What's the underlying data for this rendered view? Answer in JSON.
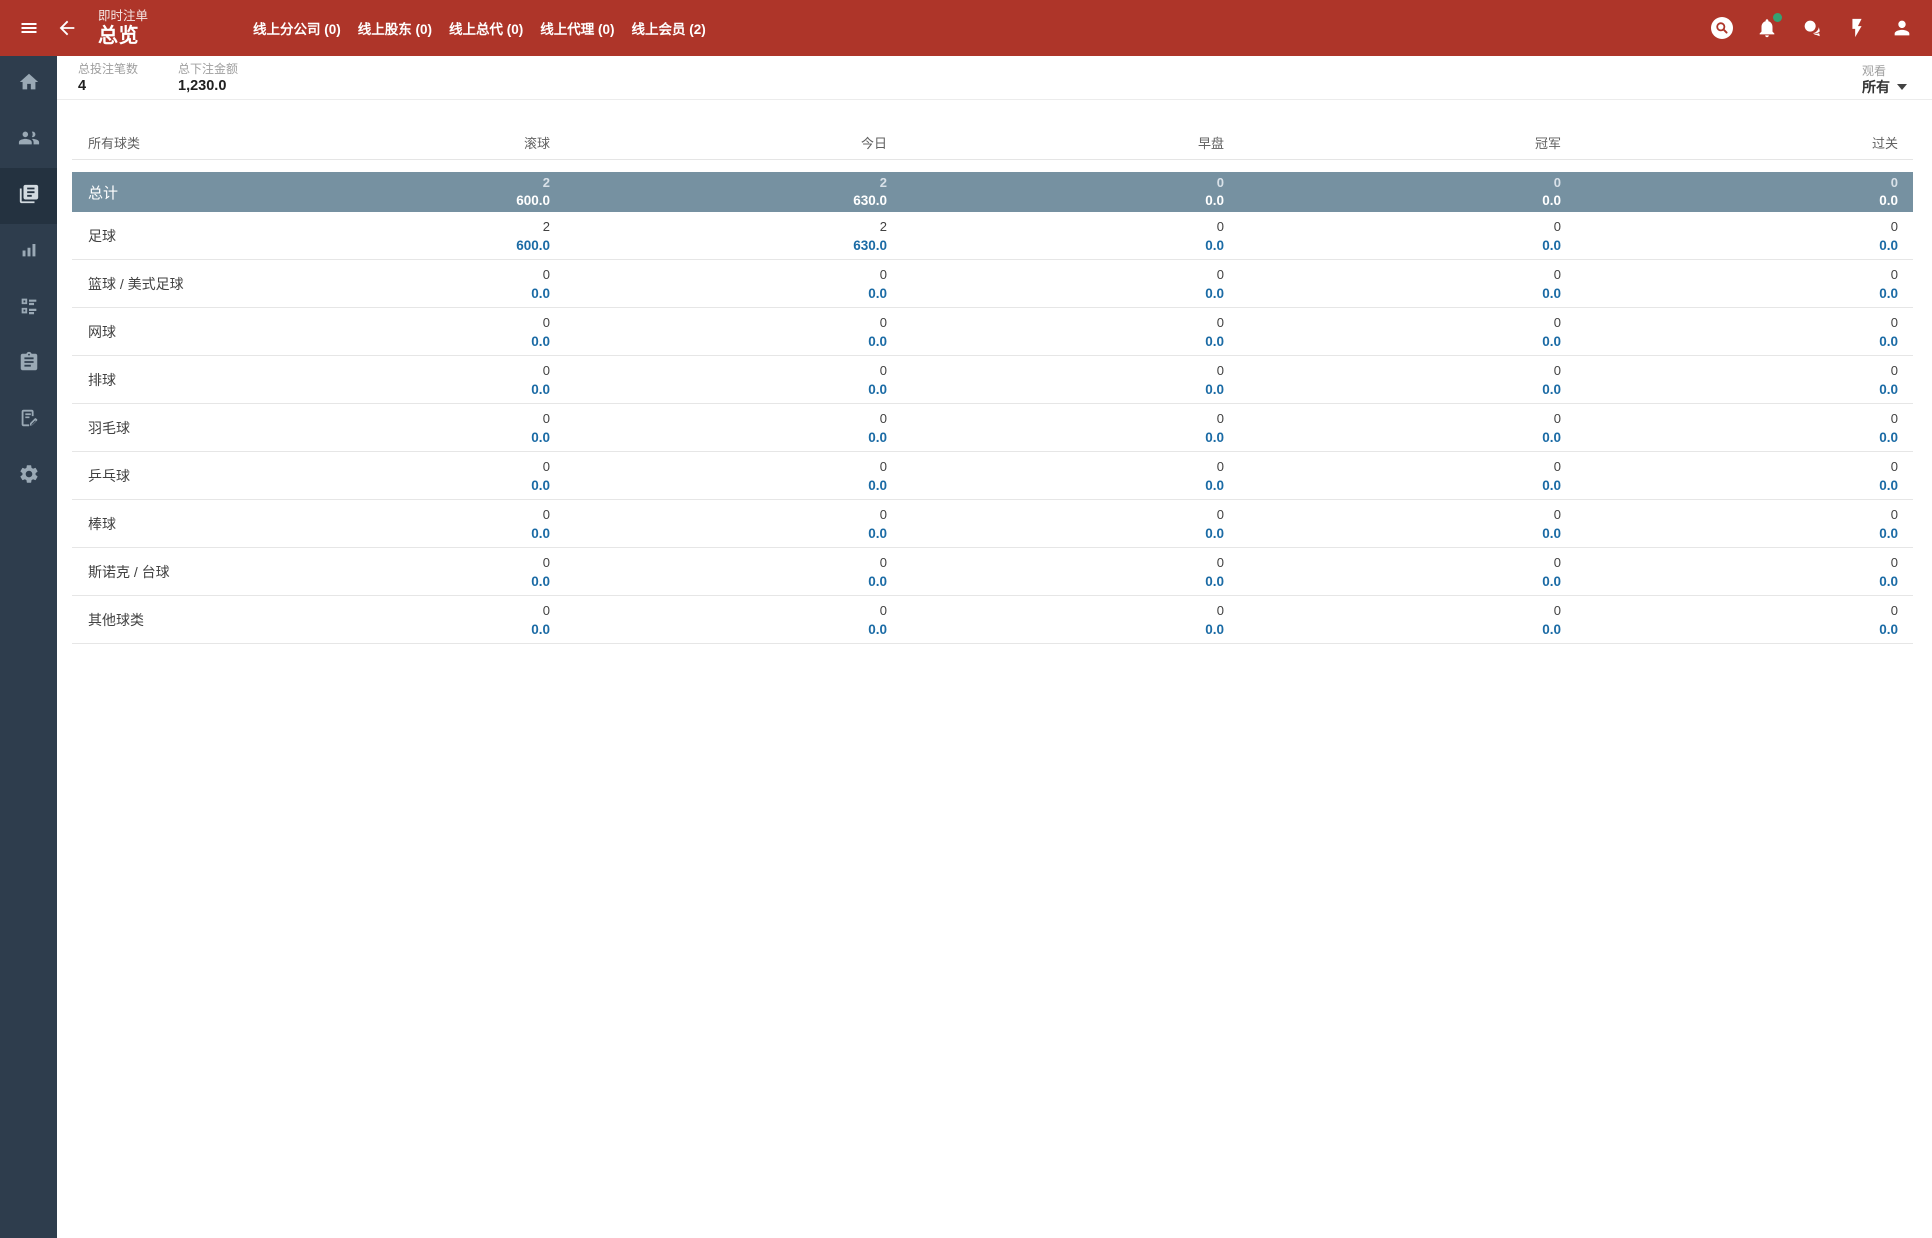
{
  "header": {
    "subtitle": "即时注单",
    "title": "总览",
    "tabs": [
      {
        "label": "线上分公司 (0)"
      },
      {
        "label": "线上股东 (0)"
      },
      {
        "label": "线上总代 (0)"
      },
      {
        "label": "线上代理 (0)"
      },
      {
        "label": "线上会员 (2)"
      }
    ],
    "action_icons": [
      "search-icon",
      "notifications-icon",
      "chat-icon",
      "flash-icon",
      "account-icon"
    ],
    "notification_dot": true
  },
  "sidebar_icons": [
    "home-icon",
    "people-icon",
    "bets-icon",
    "chart-icon",
    "ballot-icon",
    "clipboard-icon",
    "report-edit-icon",
    "settings-icon"
  ],
  "sidebar_active_index": 2,
  "stats": [
    {
      "label": "总投注笔数",
      "value": "4"
    },
    {
      "label": "总下注金额",
      "value": "1,230.0"
    }
  ],
  "watch": {
    "label": "观看",
    "value": "所有"
  },
  "table": {
    "columns": [
      "所有球类",
      "滚球",
      "今日",
      "早盘",
      "冠军",
      "过关"
    ],
    "total_row": {
      "label": "总计",
      "cells": [
        {
          "count": "2",
          "amount": "600.0"
        },
        {
          "count": "2",
          "amount": "630.0"
        },
        {
          "count": "0",
          "amount": "0.0"
        },
        {
          "count": "0",
          "amount": "0.0"
        },
        {
          "count": "0",
          "amount": "0.0"
        }
      ]
    },
    "rows": [
      {
        "label": "足球",
        "cells": [
          {
            "count": "2",
            "amount": "600.0"
          },
          {
            "count": "2",
            "amount": "630.0"
          },
          {
            "count": "0",
            "amount": "0.0"
          },
          {
            "count": "0",
            "amount": "0.0"
          },
          {
            "count": "0",
            "amount": "0.0"
          }
        ]
      },
      {
        "label": "篮球 / 美式足球",
        "cells": [
          {
            "count": "0",
            "amount": "0.0"
          },
          {
            "count": "0",
            "amount": "0.0"
          },
          {
            "count": "0",
            "amount": "0.0"
          },
          {
            "count": "0",
            "amount": "0.0"
          },
          {
            "count": "0",
            "amount": "0.0"
          }
        ]
      },
      {
        "label": "网球",
        "cells": [
          {
            "count": "0",
            "amount": "0.0"
          },
          {
            "count": "0",
            "amount": "0.0"
          },
          {
            "count": "0",
            "amount": "0.0"
          },
          {
            "count": "0",
            "amount": "0.0"
          },
          {
            "count": "0",
            "amount": "0.0"
          }
        ]
      },
      {
        "label": "排球",
        "cells": [
          {
            "count": "0",
            "amount": "0.0"
          },
          {
            "count": "0",
            "amount": "0.0"
          },
          {
            "count": "0",
            "amount": "0.0"
          },
          {
            "count": "0",
            "amount": "0.0"
          },
          {
            "count": "0",
            "amount": "0.0"
          }
        ]
      },
      {
        "label": "羽毛球",
        "cells": [
          {
            "count": "0",
            "amount": "0.0"
          },
          {
            "count": "0",
            "amount": "0.0"
          },
          {
            "count": "0",
            "amount": "0.0"
          },
          {
            "count": "0",
            "amount": "0.0"
          },
          {
            "count": "0",
            "amount": "0.0"
          }
        ]
      },
      {
        "label": "乒乓球",
        "cells": [
          {
            "count": "0",
            "amount": "0.0"
          },
          {
            "count": "0",
            "amount": "0.0"
          },
          {
            "count": "0",
            "amount": "0.0"
          },
          {
            "count": "0",
            "amount": "0.0"
          },
          {
            "count": "0",
            "amount": "0.0"
          }
        ]
      },
      {
        "label": "棒球",
        "cells": [
          {
            "count": "0",
            "amount": "0.0"
          },
          {
            "count": "0",
            "amount": "0.0"
          },
          {
            "count": "0",
            "amount": "0.0"
          },
          {
            "count": "0",
            "amount": "0.0"
          },
          {
            "count": "0",
            "amount": "0.0"
          }
        ]
      },
      {
        "label": "斯诺克 / 台球",
        "cells": [
          {
            "count": "0",
            "amount": "0.0"
          },
          {
            "count": "0",
            "amount": "0.0"
          },
          {
            "count": "0",
            "amount": "0.0"
          },
          {
            "count": "0",
            "amount": "0.0"
          },
          {
            "count": "0",
            "amount": "0.0"
          }
        ]
      },
      {
        "label": "其他球类",
        "cells": [
          {
            "count": "0",
            "amount": "0.0"
          },
          {
            "count": "0",
            "amount": "0.0"
          },
          {
            "count": "0",
            "amount": "0.0"
          },
          {
            "count": "0",
            "amount": "0.0"
          },
          {
            "count": "0",
            "amount": "0.0"
          }
        ]
      }
    ]
  },
  "colors": {
    "appbar_red": "#ae3529",
    "sidebar_dark": "#2e3d4d",
    "total_row_band": "#7691a1",
    "amount_link_blue": "#1b6ba5",
    "notification_green": "#35a173"
  }
}
